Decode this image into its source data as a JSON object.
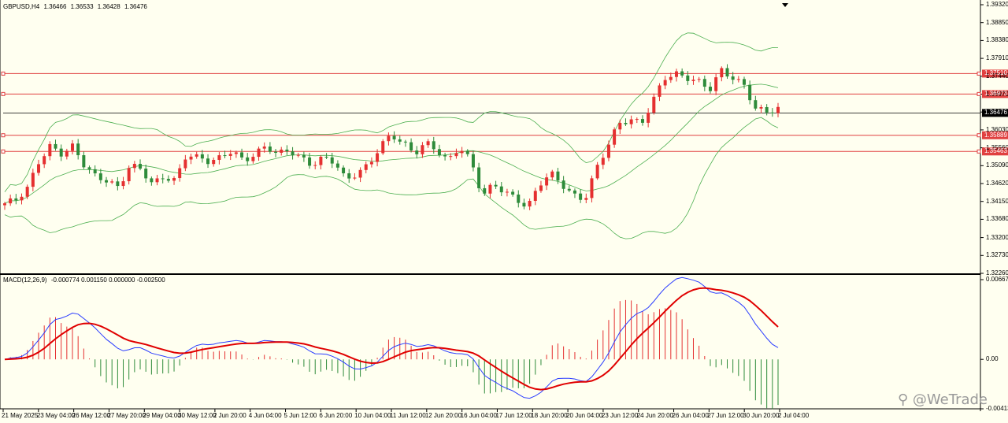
{
  "header": {
    "symbol": "GBPUSD,H4",
    "open": "1.36466",
    "high": "1.36533",
    "low": "1.36428",
    "close": "1.36476"
  },
  "macd_header": {
    "name": "MACD(12,26,9)",
    "values": "-0.000774 0.001150 0.000000 -0.002500"
  },
  "watermark": "@WeTrade",
  "colors": {
    "background": "#fffff0",
    "bull": "#2e8b3a",
    "bear": "#e53030",
    "band": "#4caf50",
    "level": "#e04040",
    "macd_line": "#2a3cff",
    "signal": "#e00000"
  },
  "chart_data": [
    {
      "type": "candlestick",
      "instrument": "GBPUSD",
      "timeframe": "H4",
      "y_ticks": [
        "1.39320",
        "1.38850",
        "1.38380",
        "1.37910",
        "1.37440",
        "1.36970",
        "1.36500",
        "1.36030",
        "1.35560",
        "1.35090",
        "1.34620",
        "1.34150",
        "1.33680",
        "1.33200",
        "1.32730",
        "1.32260"
      ],
      "ylim": [
        1.3226,
        1.3932
      ],
      "levels": [
        {
          "label": "1.37510",
          "value": 1.3751
        },
        {
          "label": "1.36973",
          "value": 1.36973
        },
        {
          "label": "1.35889",
          "value": 1.35889
        },
        {
          "label": "1.35463",
          "value": 1.35463
        }
      ],
      "current_price": {
        "label": "1.36476",
        "value": 1.36476
      },
      "x_labels": [
        "21 May 2025",
        "23 May 04:00",
        "26 May 12:00",
        "27 May 20:00",
        "29 May 04:00",
        "30 May 12:00",
        "2 Jun 20:00",
        "4 Jun 04:00",
        "5 Jun 12:00",
        "6 Jun 20:00",
        "10 Jun 04:00",
        "11 Jun 12:00",
        "12 Jun 20:00",
        "16 Jun 04:00",
        "17 Jun 12:00",
        "18 Jun 20:00",
        "20 Jun 04:00",
        "23 Jun 12:00",
        "24 Jun 20:00",
        "26 Jun 04:00",
        "27 Jun 12:00",
        "30 Jun 20:00",
        "2 Jul 04:00"
      ],
      "close_anchors": [
        1.341,
        1.342,
        1.345,
        1.352,
        1.356,
        1.354,
        1.356,
        1.351,
        1.348,
        1.347,
        1.345,
        1.351,
        1.35,
        1.346,
        1.348,
        1.347,
        1.354,
        1.353,
        1.352,
        1.353,
        1.355,
        1.352,
        1.354,
        1.356,
        1.354,
        1.355,
        1.353,
        1.351,
        1.353,
        1.352,
        1.347,
        1.349,
        1.351,
        1.356,
        1.359,
        1.357,
        1.354,
        1.357,
        1.355,
        1.352,
        1.356,
        1.352,
        1.343,
        1.346,
        1.344,
        1.342,
        1.34,
        1.346,
        1.349,
        1.346,
        1.343,
        1.342,
        1.35,
        1.356,
        1.362,
        1.363,
        1.362,
        1.368,
        1.374,
        1.375,
        1.374,
        1.373,
        1.371,
        1.376,
        1.374,
        1.372,
        1.366,
        1.365,
        1.366
      ]
    },
    {
      "type": "histogram+line",
      "name": "MACD(12,26,9)",
      "y_ticks": [
        "0.00667",
        "0.00",
        "-0.004139"
      ],
      "ylim": [
        -0.004139,
        0.00667
      ],
      "macd": -0.000774,
      "signal": 0.00115
    }
  ]
}
